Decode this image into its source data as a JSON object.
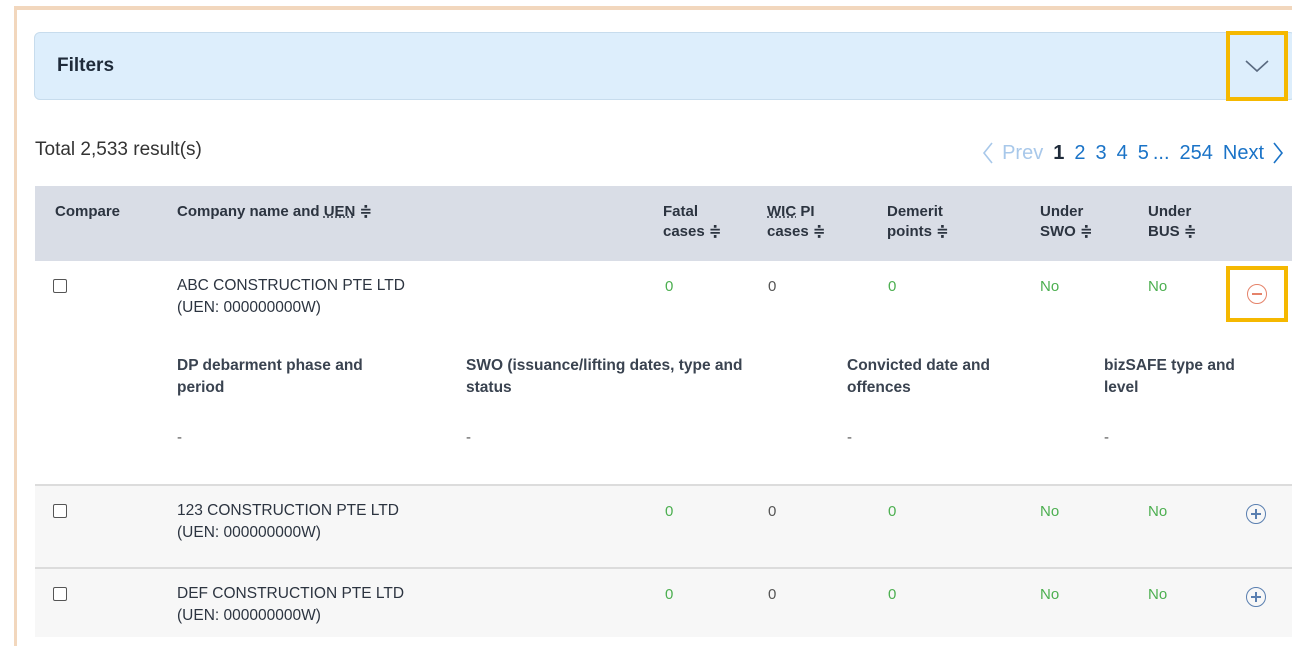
{
  "filters": {
    "title": "Filters"
  },
  "results": {
    "total_text": "Total 2,533 result(s)"
  },
  "pagination": {
    "prev_label": "Prev",
    "pages": [
      "1",
      "2",
      "3",
      "4",
      "5"
    ],
    "ellipsis": "...",
    "last_page": "254",
    "next_label": "Next",
    "current_page": "1"
  },
  "table": {
    "headers": {
      "compare": "Compare",
      "company_prefix": "Company name and ",
      "company_uen": "UEN",
      "fatal_1": "Fatal",
      "fatal_2": "cases",
      "wic_1a": "WIC",
      "wic_1b": " PI",
      "wic_2": "cases",
      "demerit_1": "Demerit",
      "demerit_2": "points",
      "swo_1": "Under",
      "swo_2": "SWO",
      "bus_1": "Under",
      "bus_2": "BUS",
      "sort_glyph": "≑"
    },
    "rows": [
      {
        "name": "ABC CONSTRUCTION PTE LTD",
        "uen": "(UEN: 000000000W)",
        "fatal": "0",
        "wic": "0",
        "demerit": "0",
        "swo": "No",
        "bus": "No",
        "expanded": true,
        "details": {
          "dp_header_1": "DP debarment phase and",
          "dp_header_2": "period",
          "swo_header_1": "SWO (issuance/lifting dates, type and",
          "swo_header_2": "status",
          "convicted_header_1": "Convicted date and",
          "convicted_header_2": "offences",
          "bizsafe_header_1": "bizSAFE type and",
          "bizsafe_header_2": "level",
          "dp_value": "-",
          "swo_value": "-",
          "convicted_value": "-",
          "bizsafe_value": "-"
        }
      },
      {
        "name": "123 CONSTRUCTION PTE LTD",
        "uen": "(UEN: 000000000W)",
        "fatal": "0",
        "wic": "0",
        "demerit": "0",
        "swo": "No",
        "bus": "No",
        "expanded": false
      },
      {
        "name": "DEF CONSTRUCTION PTE LTD",
        "uen": "(UEN: 000000000W)",
        "fatal": "0",
        "wic": "0",
        "demerit": "0",
        "swo": "No",
        "bus": "No",
        "expanded": false
      }
    ]
  },
  "colors": {
    "filter_bar_bg": "#ddeefc",
    "highlight_border": "#f5b800",
    "link_blue": "#1a73c7",
    "value_green": "#4caf50",
    "header_bg": "#d9dde6"
  }
}
